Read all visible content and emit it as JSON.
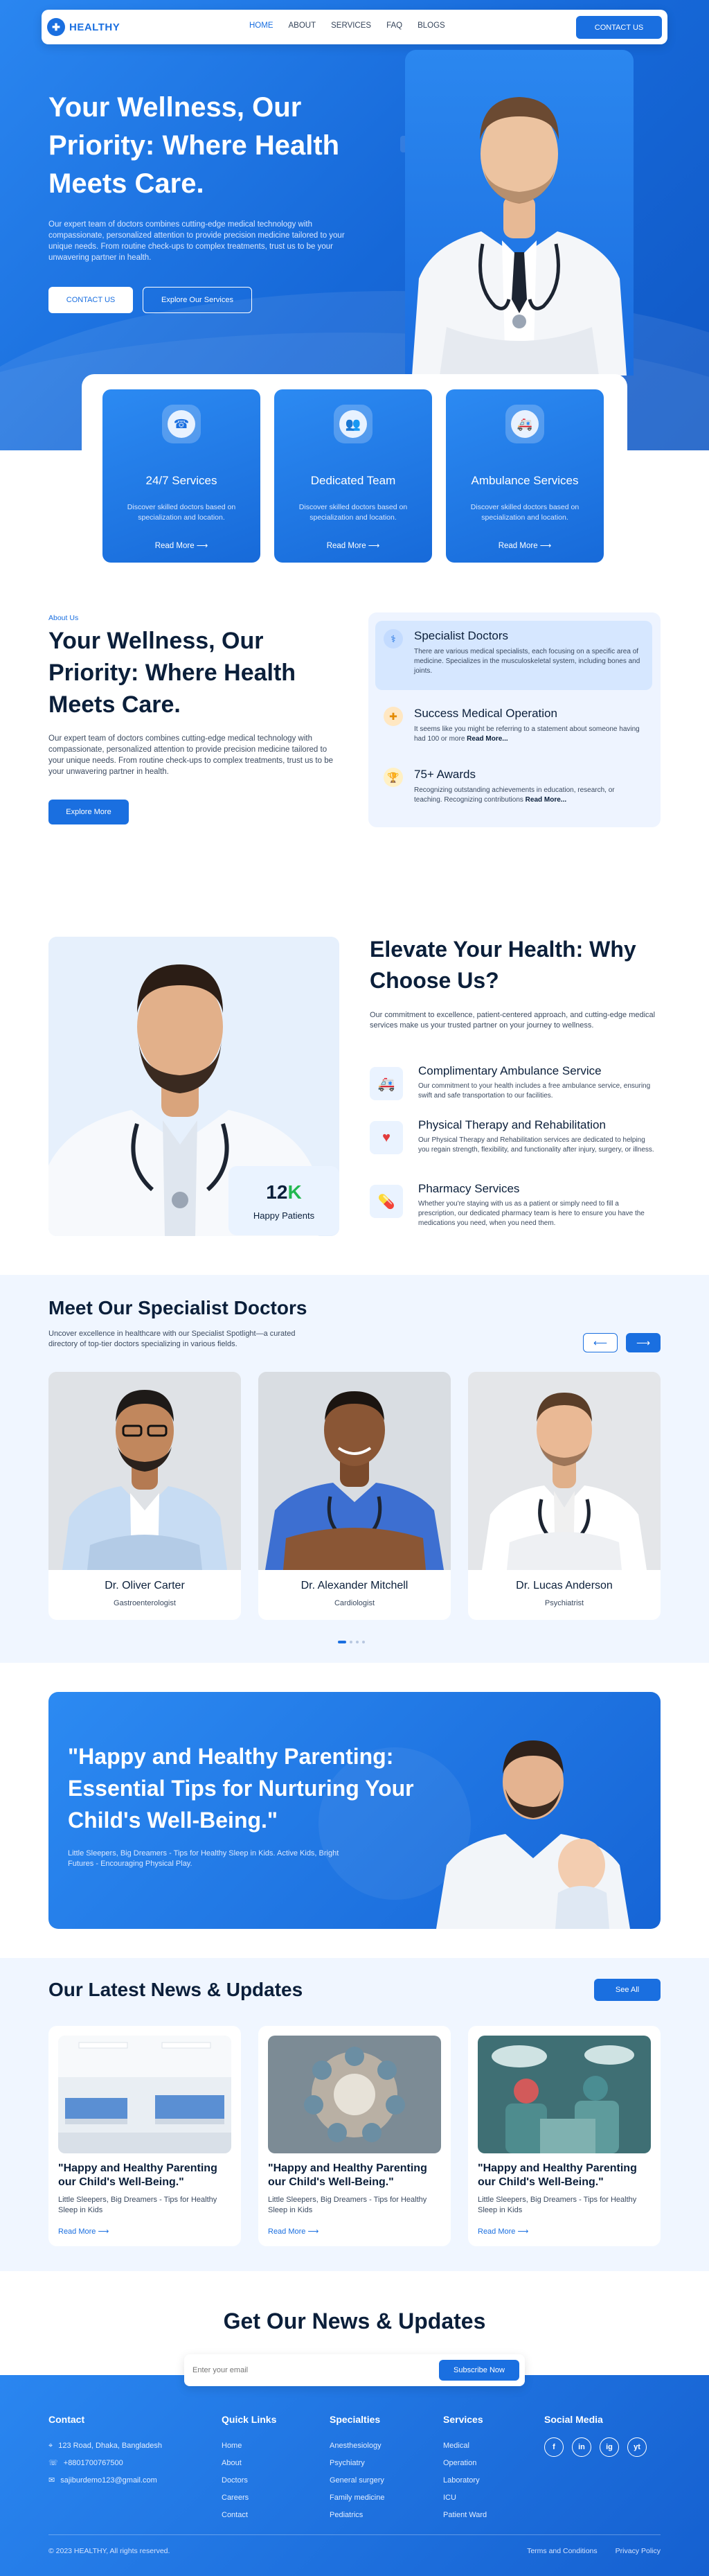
{
  "brand": {
    "name": "HEALTHY"
  },
  "nav": {
    "items": [
      "HOME",
      "ABOUT",
      "SERVICES",
      "FAQ",
      "BLOGS"
    ],
    "cta": "CONTACT US"
  },
  "hero": {
    "title": "Your Wellness, Our Priority: Where Health Meets Care.",
    "description": "Our expert team of doctors combines cutting-edge medical technology with compassionate, personalized attention to provide precision medicine tailored to your unique needs. From routine check-ups to complex treatments, trust us to be your unwavering partner in health.",
    "primary_button": "CONTACT US",
    "secondary_button": "Explore Our Services"
  },
  "services": [
    {
      "icon": "support-agent-icon",
      "title": "24/7 Services",
      "description": "Discover skilled doctors based on specialization and location.",
      "link": "Read More"
    },
    {
      "icon": "team-icon",
      "title": "Dedicated Team",
      "description": "Discover skilled doctors based on specialization and location.",
      "link": "Read More"
    },
    {
      "icon": "ambulance-icon",
      "title": "Ambulance Services",
      "description": "Discover skilled doctors based on specialization and location.",
      "link": "Read More"
    }
  ],
  "about": {
    "tag": "About Us",
    "title": "Your Wellness, Our Priority: Where Health Meets Care.",
    "description": "Our expert team of doctors combines cutting-edge medical technology with compassionate, personalized attention to provide precision medicine tailored to your unique needs. From routine check-ups to complex treatments, trust us to be your unwavering partner in health.",
    "button": "Explore More",
    "features": [
      {
        "icon": "doctor-icon",
        "title": "Specialist Doctors",
        "description": "There are various medical specialists, each focusing on a specific area of medicine. Specializes in the musculoskeletal system, including bones and joints.",
        "link": ""
      },
      {
        "icon": "medical-badge-icon",
        "title": "Success Medical Operation",
        "description": "It seems like you might be referring to a statement about someone having had 100 or more",
        "link": "Read More..."
      },
      {
        "icon": "trophy-icon",
        "title": "75+ Awards",
        "description": "Recognizing outstanding achievements in education, research, or teaching. Recognizing contributions",
        "link": "Read More..."
      }
    ]
  },
  "why": {
    "title": "Elevate Your Health: Why Choose Us?",
    "description": "Our commitment to excellence, patient-centered approach, and cutting-edge medical services make us your trusted partner on your journey to wellness.",
    "stat_number": "12",
    "stat_suffix": "K",
    "stat_label": "Happy Patients",
    "items": [
      {
        "icon": "ambulance-icon",
        "title": "Complimentary Ambulance Service",
        "description": "Our commitment to your health includes a free ambulance service, ensuring swift and safe transportation to our facilities."
      },
      {
        "icon": "heart-icon",
        "title": "Physical Therapy and Rehabilitation",
        "description": "Our Physical Therapy and Rehabilitation services are dedicated to helping you regain strength, flexibility, and functionality after injury, surgery, or illness."
      },
      {
        "icon": "pharmacy-icon",
        "title": "Pharmacy Services",
        "description": "Whether you're staying with us as a patient or simply need to fill a prescription, our dedicated pharmacy team is here to ensure you have the medications you need, when you need them."
      }
    ]
  },
  "doctors": {
    "title": "Meet Our Specialist Doctors",
    "description": "Uncover excellence in healthcare with our Specialist Spotlight—a curated directory of top-tier doctors specializing in various fields.",
    "list": [
      {
        "name": "Dr. Oliver Carter",
        "role": "Gastroenterologist"
      },
      {
        "name": "Dr. Alexander Mitchell",
        "role": "Cardiologist"
      },
      {
        "name": "Dr. Lucas Anderson",
        "role": "Psychiatrist"
      }
    ]
  },
  "banner": {
    "title": "\"Happy and Healthy Parenting: Essential Tips for Nurturing Your Child's Well-Being.\"",
    "description": "Little Sleepers, Big Dreamers - Tips for Healthy Sleep in Kids. Active Kids, Bright Futures - Encouraging Physical Play."
  },
  "news": {
    "title": "Our Latest News & Updates",
    "see_all": "See All",
    "items": [
      {
        "title": "\"Happy and Healthy Parenting our Child's Well-Being.\"",
        "description": "Little Sleepers, Big Dreamers - Tips for Healthy Sleep in Kids",
        "link": "Read More"
      },
      {
        "title": "\"Happy and Healthy Parenting our Child's Well-Being.\"",
        "description": "Little Sleepers, Big Dreamers - Tips for Healthy Sleep in Kids",
        "link": "Read More"
      },
      {
        "title": "\"Happy and Healthy Parenting our Child's Well-Being.\"",
        "description": "Little Sleepers, Big Dreamers - Tips for Healthy Sleep in Kids",
        "link": "Read More"
      }
    ]
  },
  "newsletter": {
    "title": "Get Our News & Updates",
    "placeholder": "Enter your email",
    "button": "Subscribe Now"
  },
  "footer": {
    "contact": {
      "heading": "Contact",
      "address": "123 Road, Dhaka, Bangladesh",
      "phone": "+8801700767500",
      "email": "sajiburdemo123@gmail.com"
    },
    "quick_links": {
      "heading": "Quick Links",
      "items": [
        "Home",
        "About",
        "Doctors",
        "Careers",
        "Contact"
      ]
    },
    "specialties": {
      "heading": "Specialties",
      "items": [
        "Anesthesiology",
        "Psychiatry",
        "General surgery",
        "Family medicine",
        "Pediatrics"
      ]
    },
    "services": {
      "heading": "Services",
      "items": [
        "Medical",
        "Operation",
        "Laboratory",
        "ICU",
        "Patient Ward"
      ]
    },
    "social": {
      "heading": "Social Media",
      "items": [
        "f",
        "in",
        "ig",
        "yt"
      ]
    },
    "copyright": "© 2023 HEALTHY, All rights reserved.",
    "legal": [
      "Terms and Conditions",
      "Privacy Policy"
    ]
  },
  "colors": {
    "primary": "#1a6fe0",
    "dark": "#0b1f3a",
    "accent_green": "#22b84f",
    "light_bg": "#f0f6ff"
  }
}
